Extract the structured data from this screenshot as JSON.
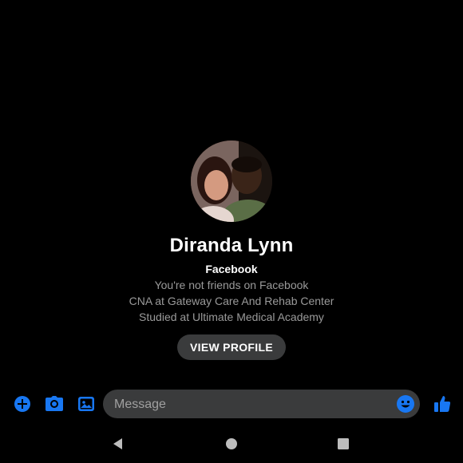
{
  "colors": {
    "background": "#000000",
    "accent": "#1877f2",
    "button_bg": "#3a3b3c",
    "secondary_text": "#9a9a9a",
    "nav_icon": "#bdbdbd"
  },
  "profile": {
    "name": "Diranda Lynn",
    "source": "Facebook",
    "friend_status": "You're not friends on Facebook",
    "work": "CNA at Gateway Care And Rehab Center",
    "education": "Studied at Ultimate Medical Academy",
    "view_profile_label": "VIEW PROFILE",
    "avatar_icon": "profile-photo"
  },
  "composer": {
    "placeholder": "Message",
    "icons": [
      "plus-icon",
      "camera-icon",
      "gallery-icon",
      "emoji-icon",
      "thumbs-up-icon"
    ]
  },
  "navbar": {
    "icons": [
      "back-triangle-icon",
      "home-circle-icon",
      "recents-square-icon"
    ]
  }
}
